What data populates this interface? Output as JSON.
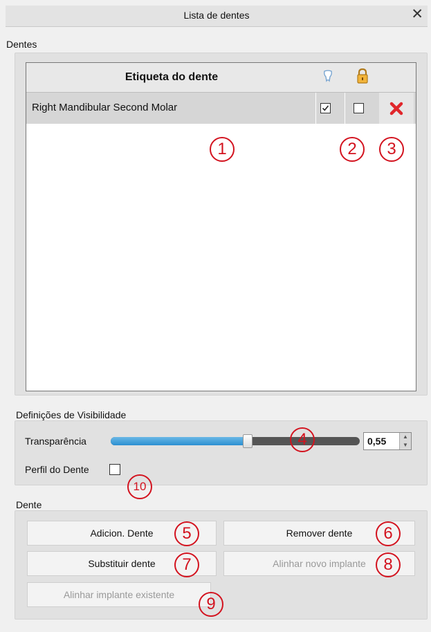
{
  "window": {
    "title": "Lista de dentes",
    "close_glyph": "✕"
  },
  "teeth": {
    "section_label": "Dentes",
    "header": {
      "label": "Etiqueta do dente",
      "visibility_icon": "tooth-icon",
      "lock_icon": "lock-icon"
    },
    "rows": [
      {
        "label": "Right Mandibular Second Molar",
        "visible": true,
        "locked": false,
        "delete_icon": "delete-x-icon"
      }
    ]
  },
  "visibility": {
    "section_label": "Definições de Visibilidade",
    "transparency_label": "Transparência",
    "transparency_value": "0,55",
    "transparency_fraction": 0.55,
    "profile_label": "Perfil do Dente",
    "profile_checked": false
  },
  "tooth": {
    "section_label": "Dente",
    "add_button": "Adicion. Dente",
    "remove_button": "Remover dente",
    "replace_button": "Substituir dente",
    "align_new_button": "Alinhar novo implante",
    "align_existing_button": "Alinhar implante existente"
  },
  "markers": [
    "1",
    "2",
    "3",
    "4",
    "5",
    "6",
    "7",
    "8",
    "9",
    "10"
  ],
  "colors": {
    "marker_red": "#d3131f",
    "delete_red": "#e0262b",
    "slider_blue": "#2b8fd1"
  }
}
